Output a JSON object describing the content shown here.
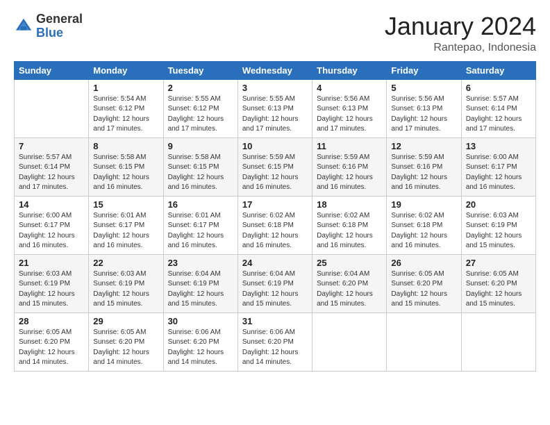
{
  "header": {
    "logo_general": "General",
    "logo_blue": "Blue",
    "title": "January 2024",
    "subtitle": "Rantepao, Indonesia"
  },
  "days_of_week": [
    "Sunday",
    "Monday",
    "Tuesday",
    "Wednesday",
    "Thursday",
    "Friday",
    "Saturday"
  ],
  "weeks": [
    [
      {
        "num": "",
        "sunrise": "",
        "sunset": "",
        "daylight": ""
      },
      {
        "num": "1",
        "sunrise": "Sunrise: 5:54 AM",
        "sunset": "Sunset: 6:12 PM",
        "daylight": "Daylight: 12 hours and 17 minutes."
      },
      {
        "num": "2",
        "sunrise": "Sunrise: 5:55 AM",
        "sunset": "Sunset: 6:12 PM",
        "daylight": "Daylight: 12 hours and 17 minutes."
      },
      {
        "num": "3",
        "sunrise": "Sunrise: 5:55 AM",
        "sunset": "Sunset: 6:13 PM",
        "daylight": "Daylight: 12 hours and 17 minutes."
      },
      {
        "num": "4",
        "sunrise": "Sunrise: 5:56 AM",
        "sunset": "Sunset: 6:13 PM",
        "daylight": "Daylight: 12 hours and 17 minutes."
      },
      {
        "num": "5",
        "sunrise": "Sunrise: 5:56 AM",
        "sunset": "Sunset: 6:13 PM",
        "daylight": "Daylight: 12 hours and 17 minutes."
      },
      {
        "num": "6",
        "sunrise": "Sunrise: 5:57 AM",
        "sunset": "Sunset: 6:14 PM",
        "daylight": "Daylight: 12 hours and 17 minutes."
      }
    ],
    [
      {
        "num": "7",
        "sunrise": "Sunrise: 5:57 AM",
        "sunset": "Sunset: 6:14 PM",
        "daylight": "Daylight: 12 hours and 17 minutes."
      },
      {
        "num": "8",
        "sunrise": "Sunrise: 5:58 AM",
        "sunset": "Sunset: 6:15 PM",
        "daylight": "Daylight: 12 hours and 16 minutes."
      },
      {
        "num": "9",
        "sunrise": "Sunrise: 5:58 AM",
        "sunset": "Sunset: 6:15 PM",
        "daylight": "Daylight: 12 hours and 16 minutes."
      },
      {
        "num": "10",
        "sunrise": "Sunrise: 5:59 AM",
        "sunset": "Sunset: 6:15 PM",
        "daylight": "Daylight: 12 hours and 16 minutes."
      },
      {
        "num": "11",
        "sunrise": "Sunrise: 5:59 AM",
        "sunset": "Sunset: 6:16 PM",
        "daylight": "Daylight: 12 hours and 16 minutes."
      },
      {
        "num": "12",
        "sunrise": "Sunrise: 5:59 AM",
        "sunset": "Sunset: 6:16 PM",
        "daylight": "Daylight: 12 hours and 16 minutes."
      },
      {
        "num": "13",
        "sunrise": "Sunrise: 6:00 AM",
        "sunset": "Sunset: 6:17 PM",
        "daylight": "Daylight: 12 hours and 16 minutes."
      }
    ],
    [
      {
        "num": "14",
        "sunrise": "Sunrise: 6:00 AM",
        "sunset": "Sunset: 6:17 PM",
        "daylight": "Daylight: 12 hours and 16 minutes."
      },
      {
        "num": "15",
        "sunrise": "Sunrise: 6:01 AM",
        "sunset": "Sunset: 6:17 PM",
        "daylight": "Daylight: 12 hours and 16 minutes."
      },
      {
        "num": "16",
        "sunrise": "Sunrise: 6:01 AM",
        "sunset": "Sunset: 6:17 PM",
        "daylight": "Daylight: 12 hours and 16 minutes."
      },
      {
        "num": "17",
        "sunrise": "Sunrise: 6:02 AM",
        "sunset": "Sunset: 6:18 PM",
        "daylight": "Daylight: 12 hours and 16 minutes."
      },
      {
        "num": "18",
        "sunrise": "Sunrise: 6:02 AM",
        "sunset": "Sunset: 6:18 PM",
        "daylight": "Daylight: 12 hours and 16 minutes."
      },
      {
        "num": "19",
        "sunrise": "Sunrise: 6:02 AM",
        "sunset": "Sunset: 6:18 PM",
        "daylight": "Daylight: 12 hours and 16 minutes."
      },
      {
        "num": "20",
        "sunrise": "Sunrise: 6:03 AM",
        "sunset": "Sunset: 6:19 PM",
        "daylight": "Daylight: 12 hours and 15 minutes."
      }
    ],
    [
      {
        "num": "21",
        "sunrise": "Sunrise: 6:03 AM",
        "sunset": "Sunset: 6:19 PM",
        "daylight": "Daylight: 12 hours and 15 minutes."
      },
      {
        "num": "22",
        "sunrise": "Sunrise: 6:03 AM",
        "sunset": "Sunset: 6:19 PM",
        "daylight": "Daylight: 12 hours and 15 minutes."
      },
      {
        "num": "23",
        "sunrise": "Sunrise: 6:04 AM",
        "sunset": "Sunset: 6:19 PM",
        "daylight": "Daylight: 12 hours and 15 minutes."
      },
      {
        "num": "24",
        "sunrise": "Sunrise: 6:04 AM",
        "sunset": "Sunset: 6:19 PM",
        "daylight": "Daylight: 12 hours and 15 minutes."
      },
      {
        "num": "25",
        "sunrise": "Sunrise: 6:04 AM",
        "sunset": "Sunset: 6:20 PM",
        "daylight": "Daylight: 12 hours and 15 minutes."
      },
      {
        "num": "26",
        "sunrise": "Sunrise: 6:05 AM",
        "sunset": "Sunset: 6:20 PM",
        "daylight": "Daylight: 12 hours and 15 minutes."
      },
      {
        "num": "27",
        "sunrise": "Sunrise: 6:05 AM",
        "sunset": "Sunset: 6:20 PM",
        "daylight": "Daylight: 12 hours and 15 minutes."
      }
    ],
    [
      {
        "num": "28",
        "sunrise": "Sunrise: 6:05 AM",
        "sunset": "Sunset: 6:20 PM",
        "daylight": "Daylight: 12 hours and 14 minutes."
      },
      {
        "num": "29",
        "sunrise": "Sunrise: 6:05 AM",
        "sunset": "Sunset: 6:20 PM",
        "daylight": "Daylight: 12 hours and 14 minutes."
      },
      {
        "num": "30",
        "sunrise": "Sunrise: 6:06 AM",
        "sunset": "Sunset: 6:20 PM",
        "daylight": "Daylight: 12 hours and 14 minutes."
      },
      {
        "num": "31",
        "sunrise": "Sunrise: 6:06 AM",
        "sunset": "Sunset: 6:20 PM",
        "daylight": "Daylight: 12 hours and 14 minutes."
      },
      {
        "num": "",
        "sunrise": "",
        "sunset": "",
        "daylight": ""
      },
      {
        "num": "",
        "sunrise": "",
        "sunset": "",
        "daylight": ""
      },
      {
        "num": "",
        "sunrise": "",
        "sunset": "",
        "daylight": ""
      }
    ]
  ]
}
